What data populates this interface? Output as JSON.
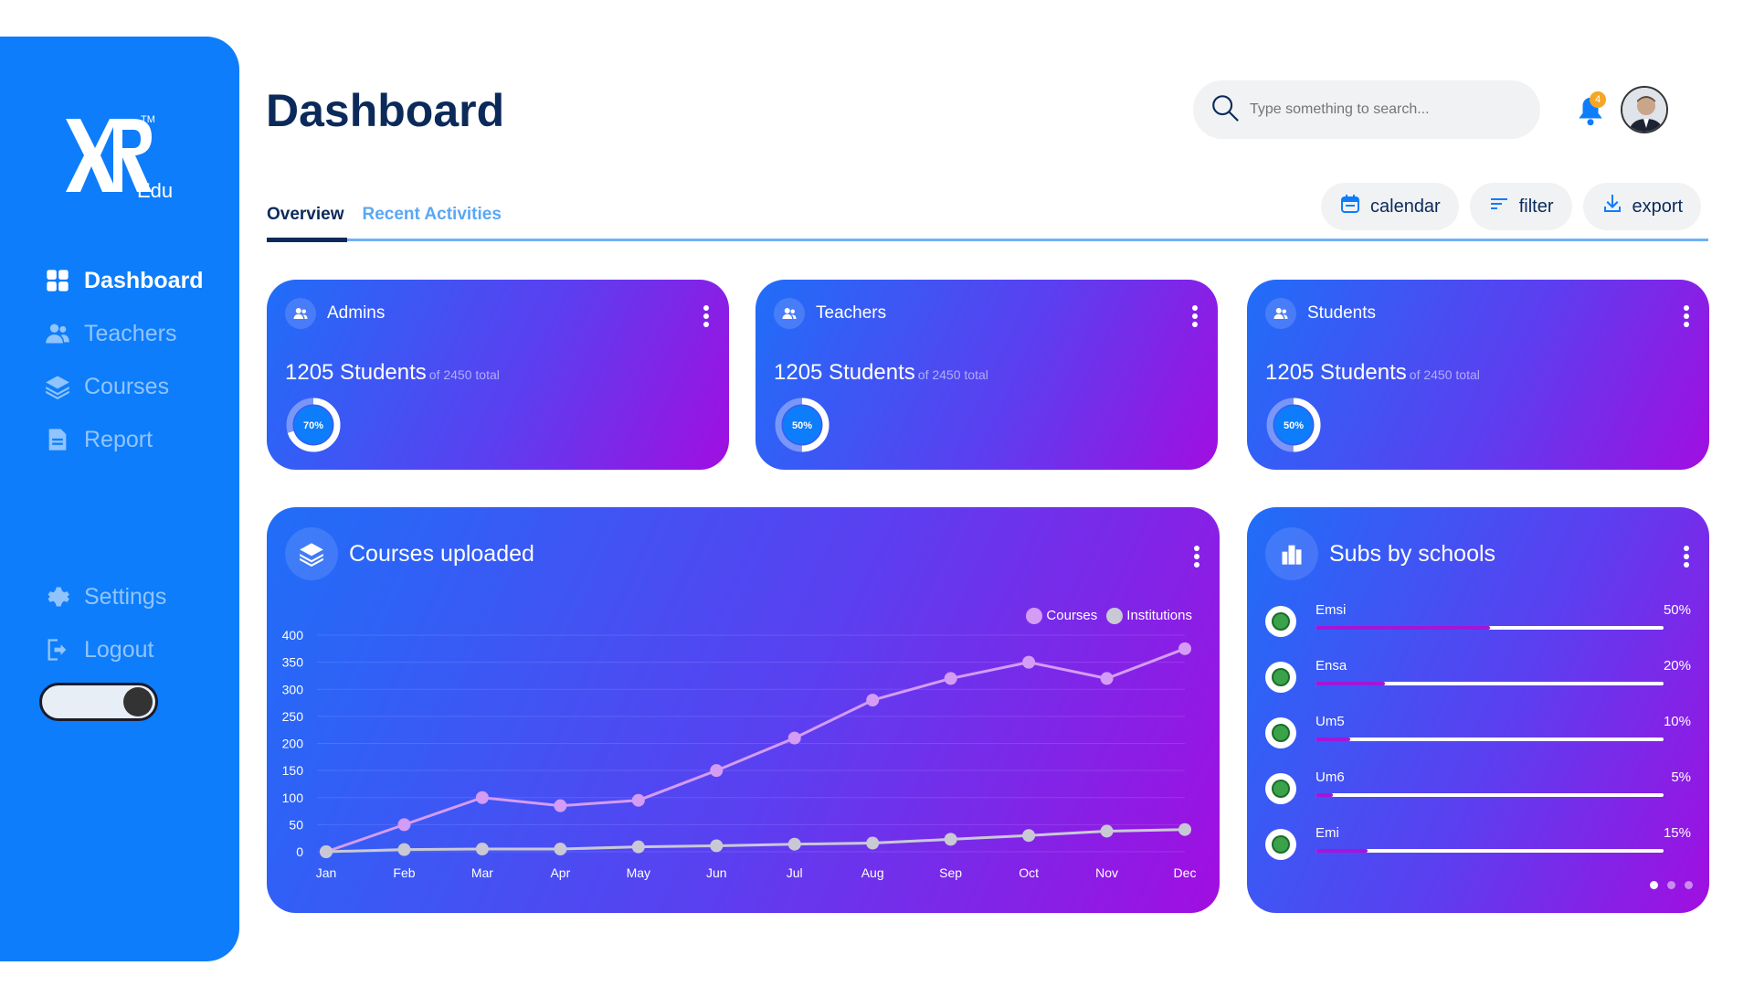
{
  "brand": {
    "name": "Edu",
    "tm": "TM"
  },
  "sidebar": {
    "items": [
      {
        "label": "Dashboard",
        "icon": "grid-icon"
      },
      {
        "label": "Teachers",
        "icon": "users-icon"
      },
      {
        "label": "Courses",
        "icon": "layers-icon"
      },
      {
        "label": "Report",
        "icon": "document-icon"
      }
    ],
    "bottom": [
      {
        "label": "Settings",
        "icon": "gear-icon"
      },
      {
        "label": "Logout",
        "icon": "logout-icon"
      }
    ]
  },
  "header": {
    "title": "Dashboard",
    "search_placeholder": "Type something to search...",
    "notifications": "4"
  },
  "tabs": [
    "Overview",
    "Recent Activities"
  ],
  "actions": [
    "calendar",
    "filter",
    "export"
  ],
  "stats": [
    {
      "title": "Admins",
      "value": "1205 Students",
      "sub": "of 2450 total",
      "pct_label": "70%",
      "pct": 0.7
    },
    {
      "title": "Teachers",
      "value": "1205 Students",
      "sub": "of 2450 total",
      "pct_label": "50%",
      "pct": 0.5
    },
    {
      "title": "Students",
      "value": "1205 Students",
      "sub": "of 2450 total",
      "pct_label": "50%",
      "pct": 0.5
    }
  ],
  "courses_card": {
    "title": "Courses uploaded"
  },
  "subs_card": {
    "title": "Subs by schools",
    "rows": [
      {
        "name": "Emsi",
        "pct_label": "50%",
        "pct": 0.5
      },
      {
        "name": "Ensa",
        "pct_label": "20%",
        "pct": 0.2
      },
      {
        "name": "Um5",
        "pct_label": "10%",
        "pct": 0.1
      },
      {
        "name": "Um6",
        "pct_label": "5%",
        "pct": 0.05
      },
      {
        "name": "Emi",
        "pct_label": "15%",
        "pct": 0.15
      }
    ],
    "pages": 3,
    "current_page": 1
  },
  "chart_data": {
    "type": "line",
    "categories": [
      "Jan",
      "Feb",
      "Mar",
      "Apr",
      "May",
      "Jun",
      "Jul",
      "Aug",
      "Sep",
      "Oct",
      "Nov",
      "Dec"
    ],
    "series": [
      {
        "name": "Courses",
        "color": "#d49cf5",
        "values": [
          0,
          50,
          100,
          85,
          95,
          150,
          210,
          280,
          320,
          350,
          320,
          375
        ]
      },
      {
        "name": "Institutions",
        "color": "#c9c9d6",
        "values": [
          0,
          4,
          5,
          5,
          9,
          11,
          14,
          16,
          23,
          30,
          38,
          41
        ]
      }
    ],
    "yticks": [
      0,
      50,
      100,
      150,
      200,
      250,
      300,
      350,
      400
    ],
    "ylim": [
      0,
      400
    ],
    "grid": true,
    "legend": "top-right"
  }
}
